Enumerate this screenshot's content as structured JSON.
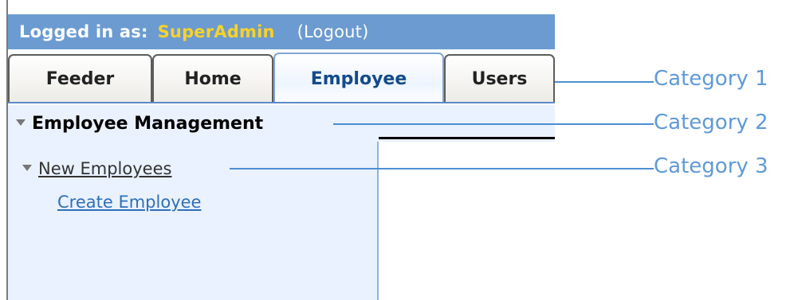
{
  "header": {
    "logged_in_label": "Logged in as:",
    "username": "SuperAdmin",
    "logout_label": "(Logout)"
  },
  "tabs": [
    {
      "label": "Feeder",
      "active": false
    },
    {
      "label": "Home",
      "active": false
    },
    {
      "label": "Employee",
      "active": true
    },
    {
      "label": "Users",
      "active": false
    }
  ],
  "section": {
    "title": "Employee Management"
  },
  "sidebar": {
    "group_title": "New Employees",
    "items": [
      {
        "label": "Create Employee"
      }
    ]
  },
  "annotations": [
    {
      "label": "Category 1"
    },
    {
      "label": "Category 2"
    },
    {
      "label": "Category 3"
    }
  ],
  "colors": {
    "header_bg": "#6b9bd0",
    "username": "#f8d22a",
    "sidebar_bg": "#eaf2ff",
    "link": "#2e6fb8",
    "annotation": "#5f9ad6"
  }
}
